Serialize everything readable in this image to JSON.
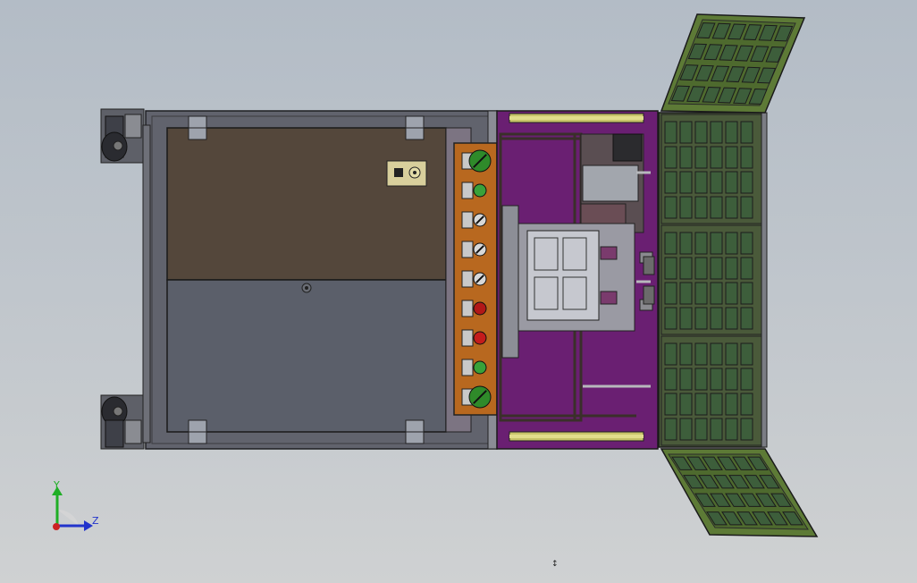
{
  "viewport": {
    "background_top": "#b3bcc6",
    "background_bottom": "#cfd1d2"
  },
  "model": {
    "frame_color": "#5d5f68",
    "top_panel_color": "#54473b",
    "bottom_panel_color": "#5b5f6a",
    "control_strip_color": "#b8681f",
    "purple_panel_color": "#6a1f72",
    "door_color": "#4a5a3a",
    "door_cell_color": "#3d5e3b",
    "open_door_color": "#5d7a36",
    "buttons": [
      {
        "type": "selector-large",
        "color": "#2f8a2a"
      },
      {
        "type": "pushbutton",
        "color": "#39a23a"
      },
      {
        "type": "selector",
        "color": "#d8d8d8"
      },
      {
        "type": "selector",
        "color": "#d8d8d8"
      },
      {
        "type": "selector",
        "color": "#d8d8d8"
      },
      {
        "type": "estop",
        "color": "#b21818"
      },
      {
        "type": "pushbutton",
        "color": "#c41c1c"
      },
      {
        "type": "pushbutton",
        "color": "#39a23a"
      },
      {
        "type": "selector-large",
        "color": "#2f8a2a"
      }
    ]
  },
  "triad": {
    "y_label": "Y",
    "z_label": "Z",
    "y_color": "#1fae25",
    "z_color": "#2233cc",
    "x_color": "#cc2222"
  },
  "status": {
    "mark": "↕"
  }
}
